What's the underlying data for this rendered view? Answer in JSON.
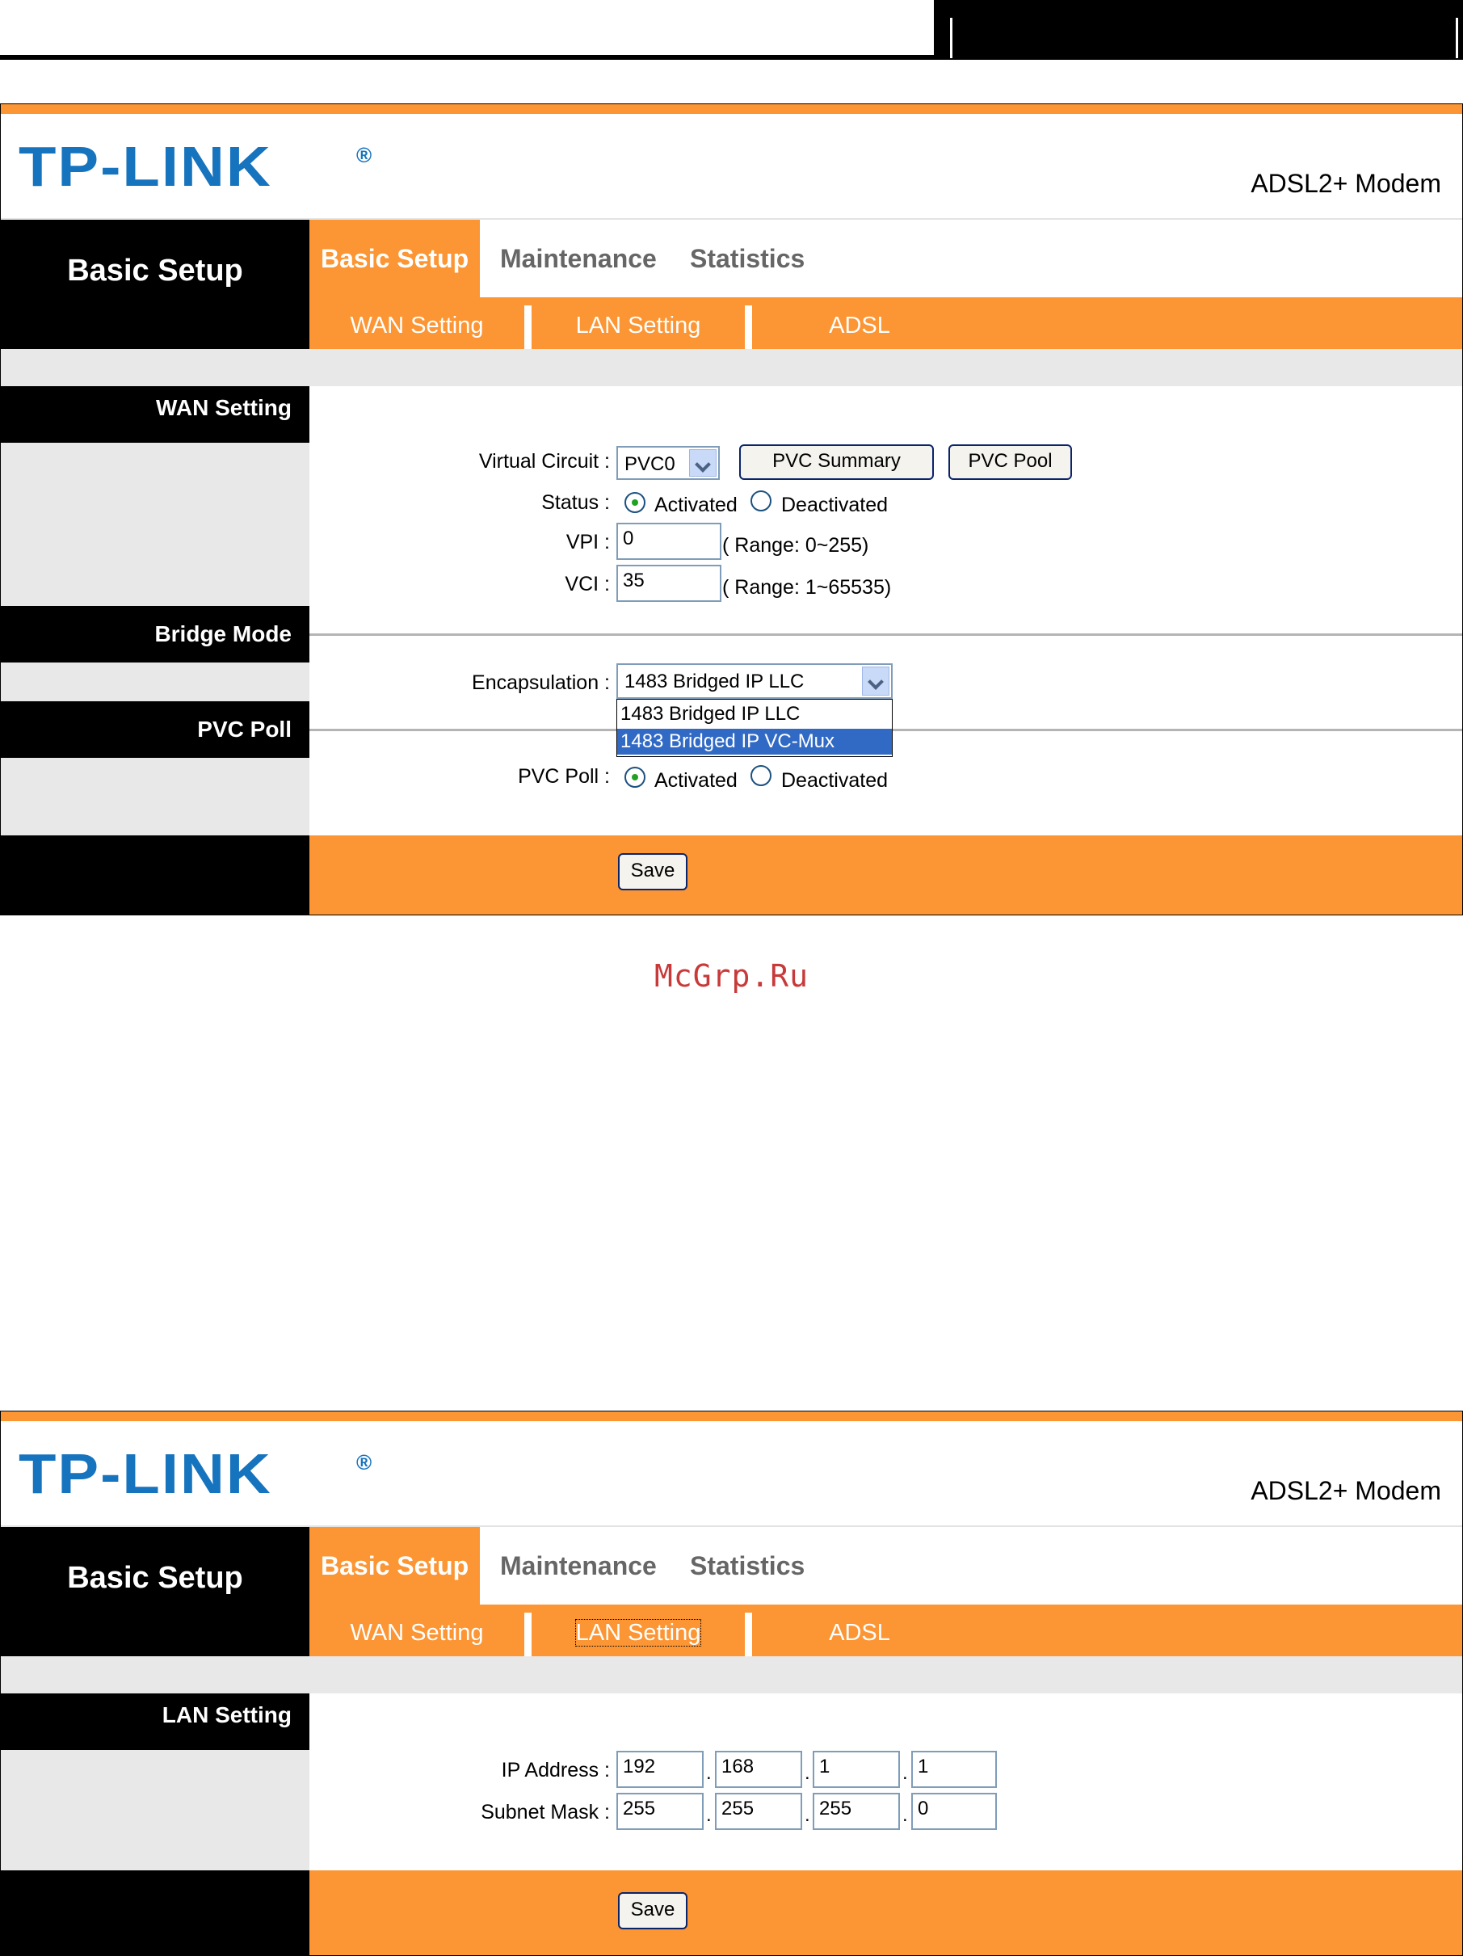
{
  "header": {},
  "watermark": "McGrp.Ru",
  "screen1": {
    "logo": "TP-LINK",
    "logo_reg": "®",
    "product": "ADSL2+ Modem",
    "nav_title": "Basic Setup",
    "tabs": [
      "Basic Setup",
      "Maintenance",
      "Statistics"
    ],
    "subtabs": [
      "WAN Setting",
      "LAN Setting",
      "ADSL"
    ],
    "sections": {
      "wan": "WAN Setting",
      "bridge": "Bridge Mode",
      "pvc": "PVC Poll"
    },
    "virtual_circuit": {
      "label": "Virtual Circuit :",
      "value": "PVC0",
      "summary_btn": "PVC Summary",
      "pool_btn": "PVC Pool"
    },
    "status": {
      "label": "Status :",
      "activated": "Activated",
      "deactivated": "Deactivated",
      "selected": "Activated"
    },
    "vpi": {
      "label": "VPI :",
      "value": "0",
      "hint": "( Range: 0~255)"
    },
    "vci": {
      "label": "VCI :",
      "value": "35",
      "hint": "( Range: 1~65535)"
    },
    "encapsulation": {
      "label": "Encapsulation :",
      "value": "1483 Bridged IP LLC",
      "options": [
        "1483 Bridged IP LLC",
        "1483 Bridged IP VC-Mux"
      ],
      "highlighted": "1483 Bridged IP VC-Mux"
    },
    "pvc_poll": {
      "label": "PVC Poll :",
      "activated": "Activated",
      "deactivated": "Deactivated",
      "selected": "Activated"
    },
    "save": "Save"
  },
  "screen2": {
    "logo": "TP-LINK",
    "logo_reg": "®",
    "product": "ADSL2+ Modem",
    "nav_title": "Basic Setup",
    "tabs": [
      "Basic Setup",
      "Maintenance",
      "Statistics"
    ],
    "subtabs": [
      "WAN Setting",
      "LAN Setting",
      "ADSL"
    ],
    "section": "LAN Setting",
    "ip_address": {
      "label": "IP Address :",
      "octets": [
        "192",
        "168",
        "1",
        "1"
      ]
    },
    "subnet_mask": {
      "label": "Subnet Mask :",
      "octets": [
        "255",
        "255",
        "255",
        "0"
      ]
    },
    "dot": ".",
    "save": "Save"
  },
  "colors": {
    "orange": "#fc9533",
    "logo_blue": "#1673be",
    "black": "#000000",
    "gray": "#e8e8e8",
    "watermark": "#c83a3a"
  }
}
